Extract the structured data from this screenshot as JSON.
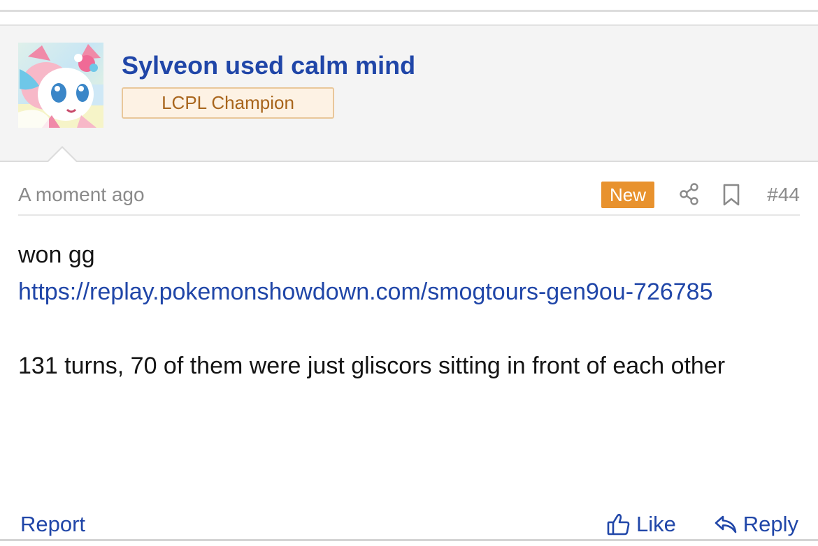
{
  "post": {
    "author": {
      "username": "Sylveon used calm mind",
      "badge": "LCPL Champion",
      "avatar_icon": "sylveon-sprite-icon"
    },
    "meta": {
      "timestamp": "A moment ago",
      "new_label": "New",
      "post_number": "#44",
      "share_icon": "share-icon",
      "bookmark_icon": "bookmark-icon"
    },
    "body": {
      "line1": "won gg",
      "link": "https://replay.pokemonshowdown.com/smogtours-gen9ou-726785",
      "line2": "131 turns, 70 of them were just gliscors sitting in front of each other"
    },
    "actions": {
      "report_label": "Report",
      "like_label": "Like",
      "reply_label": "Reply"
    }
  },
  "colors": {
    "link": "#2046a8",
    "badge_text": "#a8651c",
    "badge_bg": "#fdf2e4",
    "new_badge_bg": "#e8922e",
    "header_bg": "#f4f4f4"
  }
}
